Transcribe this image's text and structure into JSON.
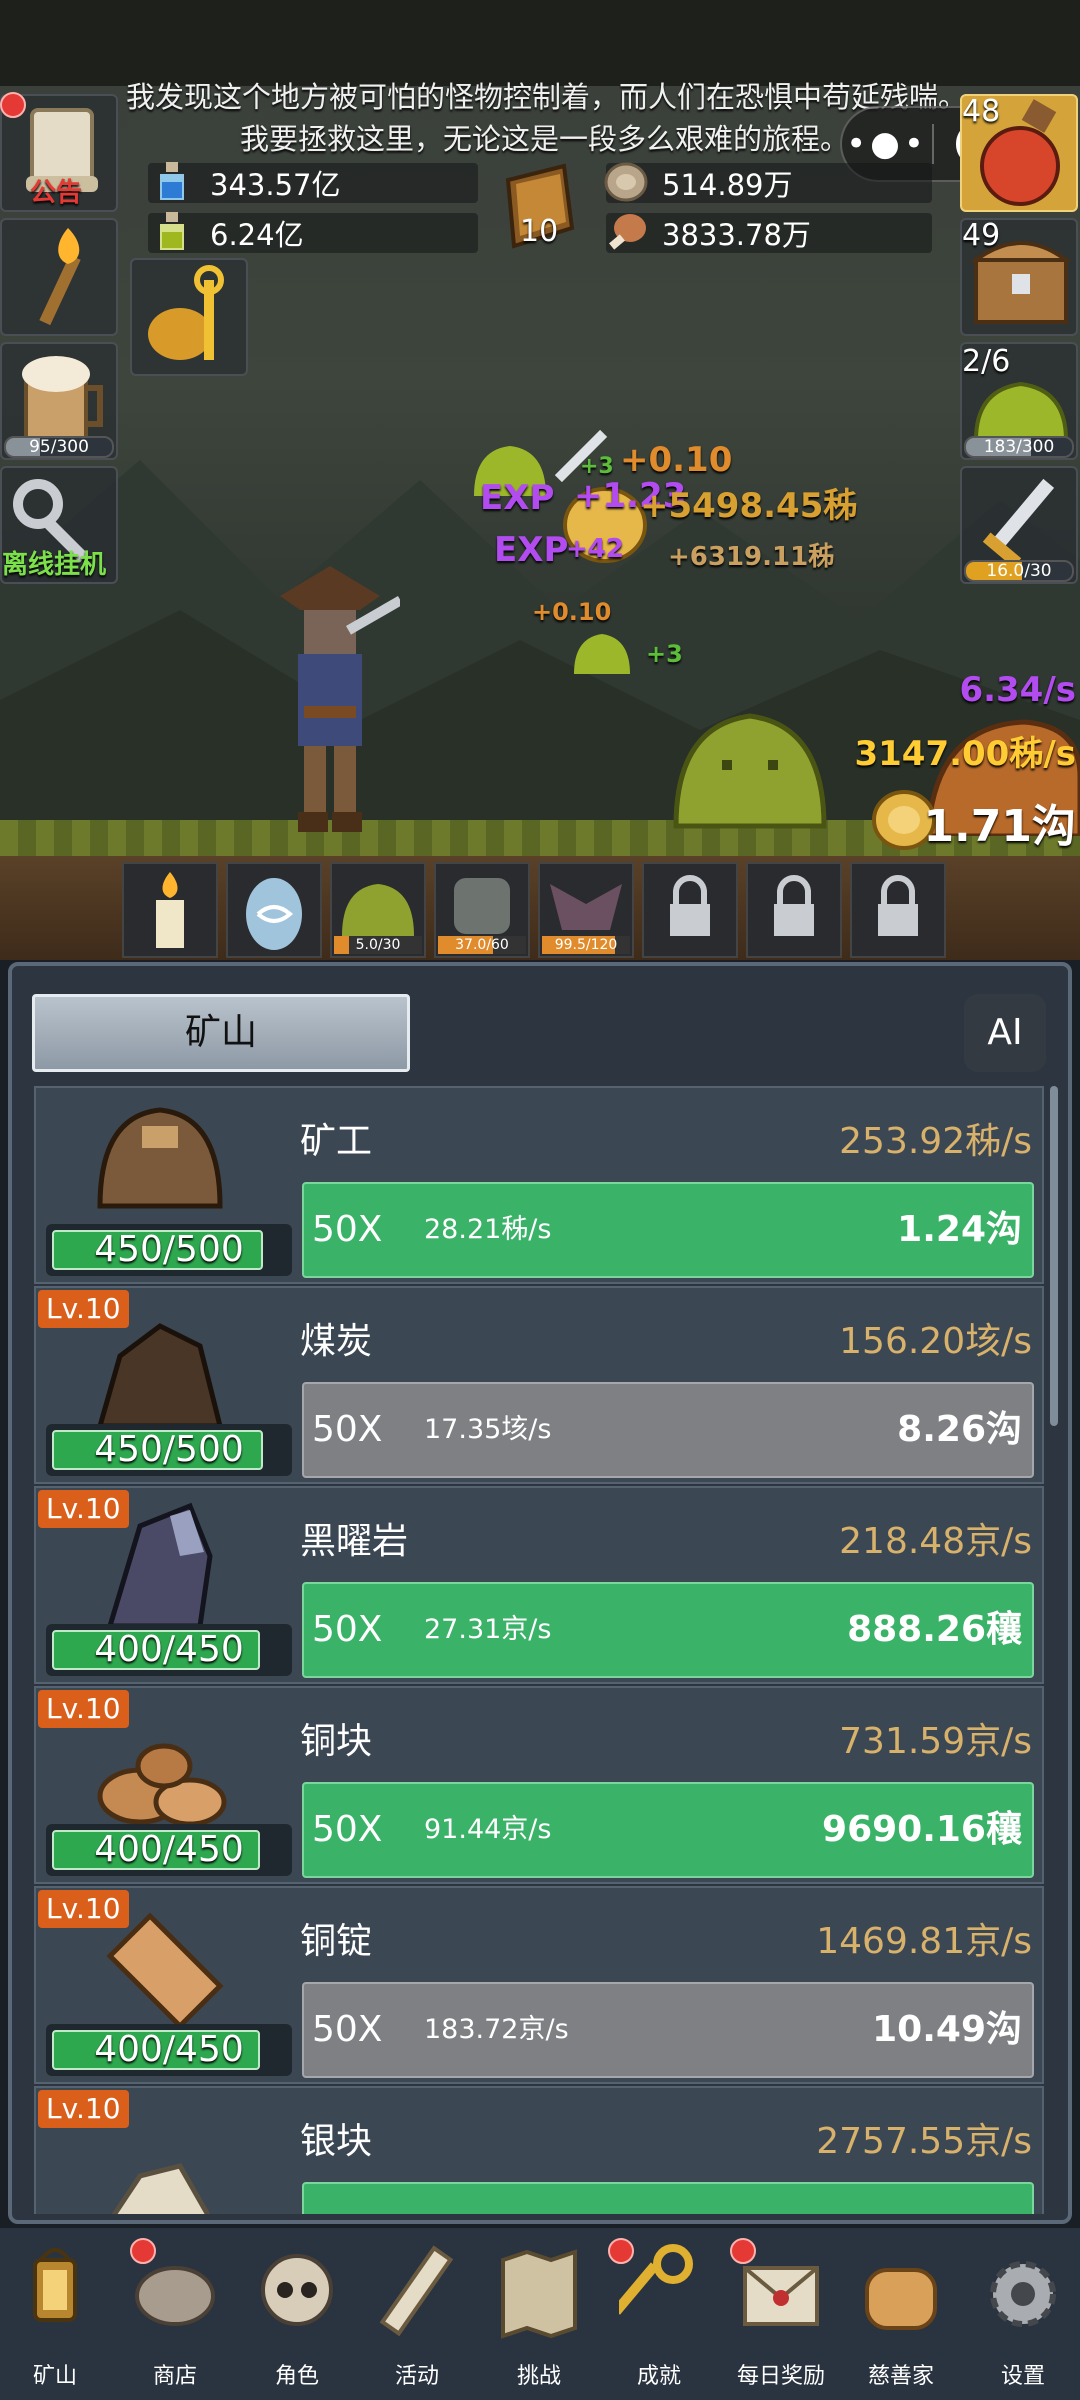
{
  "story": {
    "line1": "我发现这个地方被可怕的怪物控制着，而人们在恐惧中苟延残喘。",
    "line2": "我要拯救这里，无论这是一段多么艰难的旅程。"
  },
  "capsule": {
    "more_icon": "more-dots-icon",
    "close_icon": "target-icon"
  },
  "resources": {
    "blue_potion": "343.57亿",
    "green_potion": "6.24亿",
    "book_count": "10",
    "silver_coin": "514.89万",
    "meat": "3833.78万"
  },
  "left_side": {
    "notice_label": "公告",
    "tankard_progress": "95/300",
    "tankard_fraction": 0.32,
    "offline_label": "离线挂机"
  },
  "right_side": {
    "potion_count": "48",
    "chest_count": "49",
    "slime_wave": "2/6",
    "slime_progress": "183/300",
    "slime_fraction": 0.61,
    "sword_progress": "16.0/30",
    "sword_fraction": 0.53
  },
  "stats": {
    "exp_rate": "6.34/s",
    "coin_rate": "3147.00秭/s",
    "coin_total": "1.71沟"
  },
  "floats": {
    "f1": "+0.10",
    "f2": "+1.23",
    "f3": "+5498.45秭",
    "f4": "+42",
    "f5": "+6319.11秭",
    "f6": "+0.10",
    "f7": "+3",
    "f8": "+3",
    "exp1": "EXP",
    "exp2": "EXP"
  },
  "monster_slots": [
    {
      "label": ""
    },
    {
      "label": ""
    },
    {
      "label": "5.0/30",
      "fraction": 0.17
    },
    {
      "label": "37.0/60",
      "fraction": 0.62
    },
    {
      "label": "99.5/120",
      "fraction": 0.83
    }
  ],
  "panel": {
    "tab_title": "矿山",
    "ai_label": "AI"
  },
  "mines": [
    {
      "name": "矿工",
      "level": "",
      "count": "450/500",
      "count_fraction": 0.9,
      "rate": "253.92秭/s",
      "mult": "50X",
      "inc": "28.21秭/s",
      "cost": "1.24沟",
      "state": "green"
    },
    {
      "name": "煤炭",
      "level": "Lv.10",
      "count": "450/500",
      "count_fraction": 0.9,
      "rate": "156.20垓/s",
      "mult": "50X",
      "inc": "17.35垓/s",
      "cost": "8.26沟",
      "state": "gray"
    },
    {
      "name": "黑曜岩",
      "level": "Lv.10",
      "count": "400/450",
      "count_fraction": 0.89,
      "rate": "218.48京/s",
      "mult": "50X",
      "inc": "27.31京/s",
      "cost": "888.26穰",
      "state": "green"
    },
    {
      "name": "铜块",
      "level": "Lv.10",
      "count": "400/450",
      "count_fraction": 0.89,
      "rate": "731.59京/s",
      "mult": "50X",
      "inc": "91.44京/s",
      "cost": "9690.16穰",
      "state": "green"
    },
    {
      "name": "铜锭",
      "level": "Lv.10",
      "count": "400/450",
      "count_fraction": 0.89,
      "rate": "1469.81京/s",
      "mult": "50X",
      "inc": "183.72京/s",
      "cost": "10.49沟",
      "state": "gray"
    },
    {
      "name": "银块",
      "level": "Lv.10",
      "count": "",
      "count_fraction": 0.9,
      "rate": "2757.55京/s",
      "mult": "",
      "inc": "",
      "cost": "",
      "state": "green"
    }
  ],
  "nav": [
    {
      "label": "矿山",
      "icon": "lantern-icon",
      "badge": false
    },
    {
      "label": "商店",
      "icon": "stone-tablet-icon",
      "badge": true
    },
    {
      "label": "角色",
      "icon": "skull-icon",
      "badge": false
    },
    {
      "label": "活动",
      "icon": "scroll-icon",
      "badge": false
    },
    {
      "label": "挑战",
      "icon": "map-icon",
      "badge": false
    },
    {
      "label": "成就",
      "icon": "key-icon",
      "badge": true
    },
    {
      "label": "每日奖励",
      "icon": "letter-icon",
      "badge": true
    },
    {
      "label": "慈善家",
      "icon": "bread-icon",
      "badge": false
    },
    {
      "label": "设置",
      "icon": "gear-icon",
      "badge": false
    }
  ],
  "colors": {
    "green_button": "#3ab368",
    "gray_button": "#7e8083",
    "rate_text": "#d8b16b",
    "level_badge": "#d95f1b",
    "exp_text": "#b34cf0",
    "coin_text": "#ffcc33"
  }
}
